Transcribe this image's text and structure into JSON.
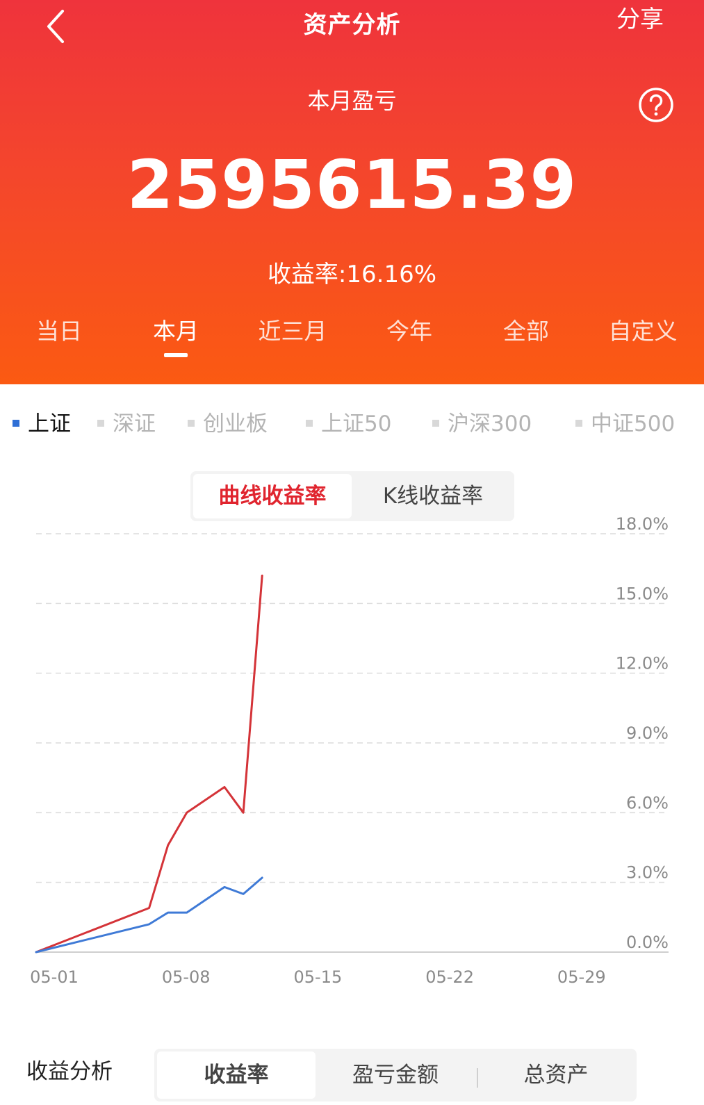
{
  "header": {
    "title": "资产分析",
    "share_label": "分享",
    "period_title": "本月盈亏",
    "amount": "2595615.39",
    "return_rate": "收益率:16.16%"
  },
  "colors": {
    "header_top": "#ef333c",
    "header_bottom": "#fb5a12",
    "accent_red": "#e0242e",
    "accent_blue": "#2f6fd6"
  },
  "period_tabs": [
    {
      "label": "当日",
      "active": false
    },
    {
      "label": "本月",
      "active": true
    },
    {
      "label": "近三月",
      "active": false
    },
    {
      "label": "今年",
      "active": false
    },
    {
      "label": "全部",
      "active": false
    },
    {
      "label": "自定义",
      "active": false
    }
  ],
  "index_tabs": [
    {
      "label": "上证",
      "active": true
    },
    {
      "label": "深证",
      "active": false
    },
    {
      "label": "创业板",
      "active": false
    },
    {
      "label": "上证50",
      "active": false
    },
    {
      "label": "沪深300",
      "active": false
    },
    {
      "label": "中证500",
      "active": false
    }
  ],
  "chart_toggle": {
    "curve_label": "曲线收益率",
    "k_label": "K线收益率",
    "selected": "curve"
  },
  "chart_data": {
    "type": "line",
    "x_ticks": [
      "05-01",
      "05-08",
      "05-15",
      "05-22",
      "05-29"
    ],
    "y_ticks": [
      "0.0%",
      "3.0%",
      "6.0%",
      "9.0%",
      "12.0%",
      "15.0%",
      "18.0%"
    ],
    "ylim": [
      0,
      18
    ],
    "xlim": [
      "05-01",
      "05-31"
    ],
    "grid": true,
    "y_axis_position": "right",
    "series": [
      {
        "color": "#d43338",
        "x": [
          "05-01",
          "05-07",
          "05-08",
          "05-09",
          "05-11",
          "05-12",
          "05-13"
        ],
        "values": [
          0.0,
          1.9,
          4.6,
          6.0,
          7.1,
          6.0,
          16.2
        ]
      },
      {
        "color": "#3f7ad6",
        "x": [
          "05-01",
          "05-07",
          "05-08",
          "05-09",
          "05-11",
          "05-12",
          "05-13"
        ],
        "values": [
          0.0,
          1.2,
          1.7,
          1.7,
          2.8,
          2.5,
          3.2
        ]
      }
    ]
  },
  "bottom": {
    "title": "收益分析",
    "tabs": [
      {
        "label": "收益率",
        "active": true
      },
      {
        "label": "盈亏金额",
        "active": false
      },
      {
        "label": "总资产",
        "active": false
      }
    ]
  }
}
